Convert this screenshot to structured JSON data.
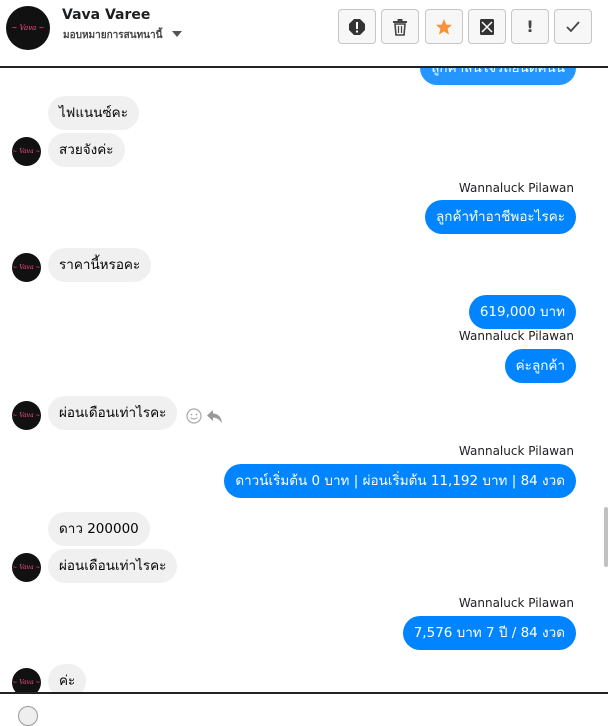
{
  "header": {
    "name": "Vava Varee",
    "subtitle": "มอบหมายการสนทนานี้",
    "avatar_logo": "~ Vava ~",
    "buttons": [
      {
        "icon": "spam-alert-icon"
      },
      {
        "icon": "trash-icon"
      },
      {
        "icon": "star-icon"
      },
      {
        "icon": "archive-envelope-icon"
      },
      {
        "icon": "exclamation-icon",
        "glyph": "!"
      },
      {
        "icon": "checkmark-icon"
      }
    ],
    "star_color": "#f7923a"
  },
  "messages": {
    "partial_top": "ลูกค้าสนใจรถยนต์คันนี้",
    "in_1": "ไฟแนนซ์คะ",
    "in_2": "สวยจังค่ะ",
    "agent_name_1": "Wannaluck Pilawan",
    "out_1": "ลูกค้าทำอาชีพอะไรคะ",
    "in_3": "ราคานี้หรอคะ",
    "out_2": "619,000 บาท",
    "agent_name_2": "Wannaluck Pilawan",
    "out_3": "ค่ะลูกค้า",
    "in_4": "ผ่อนเดือนเท่าไรคะ",
    "agent_name_3": "Wannaluck Pilawan",
    "out_4": "ดาวน์เริ่มต้น 0 บาท | ผ่อนเริ่มต้น 11,192 บาท | 84 งวด",
    "in_5": "ดาว 200000",
    "in_6": "ผ่อนเดือนเท่าไรคะ",
    "agent_name_4": "Wannaluck Pilawan",
    "out_5": "7,576 บาท  7 ปี / 84 งวด",
    "in_7": "ค่ะ"
  },
  "colors": {
    "outgoing_bubble": "#0084ff",
    "incoming_bubble": "#f0f0f0"
  }
}
